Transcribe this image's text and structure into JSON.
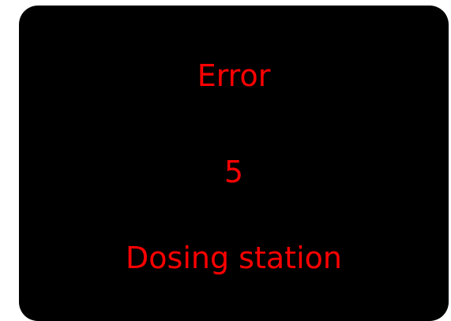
{
  "error_display": {
    "title": "Error",
    "code": "5",
    "description": "Dosing station"
  },
  "colors": {
    "screen_background": "#000000",
    "text": "#ff0000",
    "page_background": "#ffffff"
  }
}
